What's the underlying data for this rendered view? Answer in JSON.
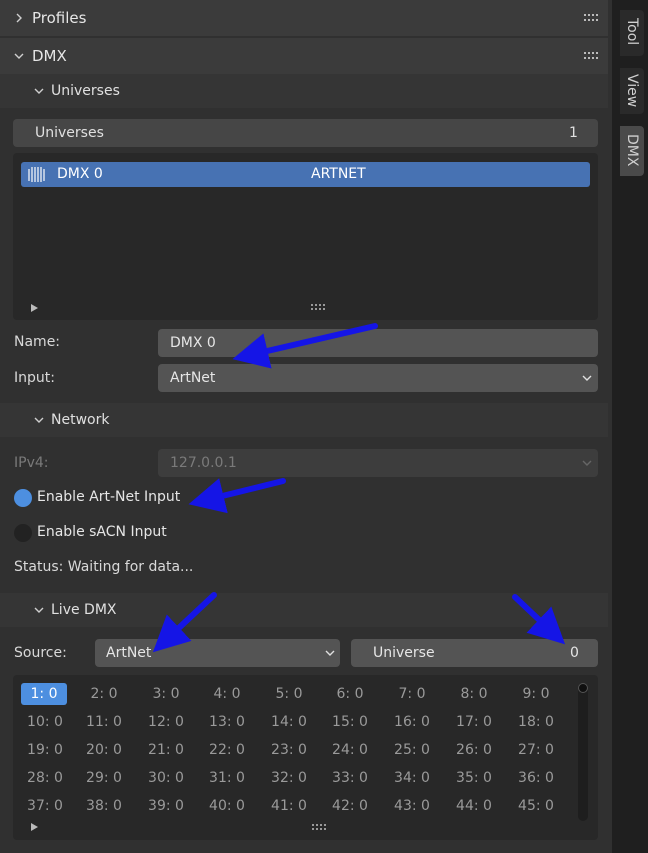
{
  "profiles": {
    "title": "Profiles"
  },
  "dmx": {
    "title": "DMX"
  },
  "universes": {
    "section_title": "Universes",
    "list_header": "Universes",
    "count": "1",
    "items": [
      {
        "name": "DMX 0",
        "type": "ARTNET"
      }
    ],
    "name_label": "Name:",
    "name_value": "DMX 0",
    "input_label": "Input:",
    "input_value": "ArtNet"
  },
  "network": {
    "title": "Network",
    "ipv4_label": "IPv4:",
    "ipv4_value": "127.0.0.1",
    "artnet_label": "Enable Art-Net Input",
    "artnet_enabled": true,
    "sacn_label": "Enable sACN Input",
    "sacn_enabled": false,
    "status": "Status: Waiting for data..."
  },
  "live_dmx": {
    "title": "Live DMX",
    "source_label": "Source:",
    "source_value": "ArtNet",
    "universe_label": "Universe",
    "universe_value": "0",
    "cells": [
      "1: 0",
      "2: 0",
      "3: 0",
      "4: 0",
      "5: 0",
      "6: 0",
      "7: 0",
      "8: 0",
      "9: 0",
      "10: 0",
      "11: 0",
      "12: 0",
      "13: 0",
      "14: 0",
      "15: 0",
      "16: 0",
      "17: 0",
      "18: 0",
      "19: 0",
      "20: 0",
      "21: 0",
      "22: 0",
      "23: 0",
      "24: 0",
      "25: 0",
      "26: 0",
      "27: 0",
      "28: 0",
      "29: 0",
      "30: 0",
      "31: 0",
      "32: 0",
      "33: 0",
      "34: 0",
      "35: 0",
      "36: 0",
      "37: 0",
      "38: 0",
      "39: 0",
      "40: 0",
      "41: 0",
      "42: 0",
      "43: 0",
      "44: 0",
      "45: 0"
    ],
    "selected_index": 0
  },
  "side_tabs": [
    "Tool",
    "View",
    "DMX"
  ],
  "colors": {
    "accent": "#4d8fe0",
    "selection": "#4772b3",
    "arrow": "#1515e6"
  }
}
